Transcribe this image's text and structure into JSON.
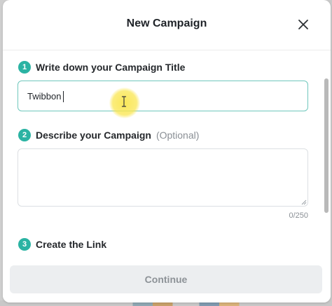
{
  "modal": {
    "title": "New Campaign",
    "close_icon": "close-icon"
  },
  "steps": [
    {
      "number": "1",
      "label": "Write down your Campaign Title",
      "optional": ""
    },
    {
      "number": "2",
      "label": "Describe your Campaign",
      "optional": "(Optional)"
    },
    {
      "number": "3",
      "label": "Create the Link",
      "optional": ""
    }
  ],
  "title_input": {
    "value": "Twibbon",
    "placeholder": ""
  },
  "description": {
    "value": "",
    "placeholder": "",
    "char_count": "0/250"
  },
  "footer": {
    "continue_label": "Continue"
  },
  "colors": {
    "accent": "#2bb3a3",
    "input_focus_border": "#6fc7bc",
    "button_disabled_bg": "#eceef0",
    "button_disabled_text": "#8d9297"
  }
}
